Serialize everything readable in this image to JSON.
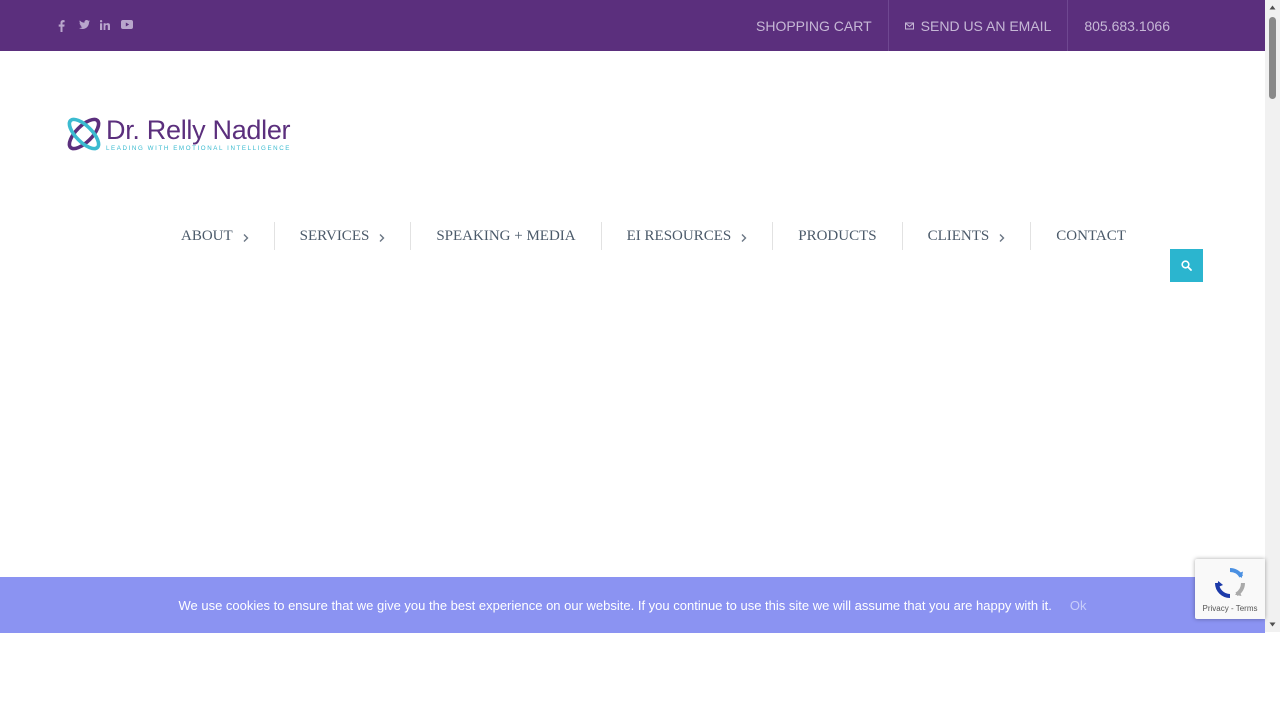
{
  "topbar": {
    "social_icons": [
      "facebook-icon",
      "twitter-icon",
      "linkedin-icon",
      "youtube-icon"
    ],
    "links": {
      "cart": "SHOPPING CART",
      "email": "SEND US AN EMAIL",
      "phone": "805.683.1066"
    },
    "bg_color": "#5b2f7d"
  },
  "logo": {
    "name": "Dr. Relly Nadler",
    "tagline": "LEADING WITH EMOTIONAL INTELLIGENCE"
  },
  "nav": {
    "items": [
      {
        "label": "ABOUT",
        "has_submenu": true
      },
      {
        "label": "SERVICES",
        "has_submenu": true
      },
      {
        "label": "SPEAKING + MEDIA",
        "has_submenu": false
      },
      {
        "label": "EI RESOURCES",
        "has_submenu": true
      },
      {
        "label": "PRODUCTS",
        "has_submenu": false
      },
      {
        "label": "CLIENTS",
        "has_submenu": true
      },
      {
        "label": "CONTACT",
        "has_submenu": false
      }
    ],
    "search_icon": "search-icon",
    "accent_color": "#2bb5cf"
  },
  "cookie": {
    "message": "We use cookies to ensure that we give you the best experience on our website. If you continue to use this site we will assume that you are happy with it.",
    "ok_label": "Ok",
    "bg_color": "#8b93f2"
  },
  "recaptcha": {
    "links": "Privacy - Terms"
  }
}
